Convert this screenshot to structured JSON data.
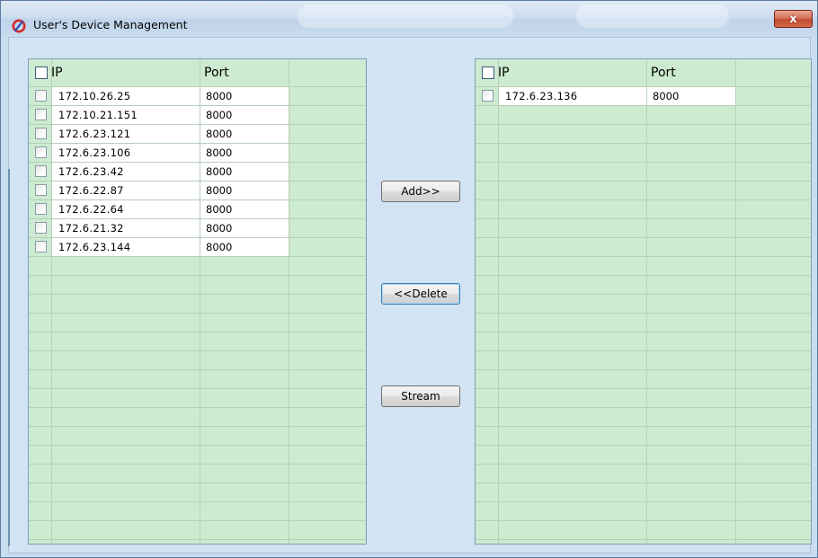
{
  "window": {
    "title": "User's Device Management",
    "close_label": "x"
  },
  "colors": {
    "list_background": "#ccebd0",
    "client_background": "#d2e3f3",
    "close_button": "#c04a2e"
  },
  "icons": {
    "app": "red-circle-logo-icon",
    "close": "close-icon"
  },
  "left_list": {
    "columns": [
      "IP",
      "Port"
    ],
    "rows": [
      {
        "ip": "172.10.26.25",
        "port": "8000"
      },
      {
        "ip": "172.10.21.151",
        "port": "8000"
      },
      {
        "ip": "172.6.23.121",
        "port": "8000"
      },
      {
        "ip": "172.6.23.106",
        "port": "8000"
      },
      {
        "ip": "172.6.23.42",
        "port": "8000"
      },
      {
        "ip": "172.6.22.87",
        "port": "8000"
      },
      {
        "ip": "172.6.22.64",
        "port": "8000"
      },
      {
        "ip": "172.6.21.32",
        "port": "8000"
      },
      {
        "ip": "172.6.23.144",
        "port": "8000"
      }
    ]
  },
  "right_list": {
    "columns": [
      "IP",
      "Port"
    ],
    "rows": [
      {
        "ip": "172.6.23.136",
        "port": "8000"
      }
    ]
  },
  "buttons": {
    "add": "Add>>",
    "delete": "<<Delete",
    "stream": "Stream"
  }
}
